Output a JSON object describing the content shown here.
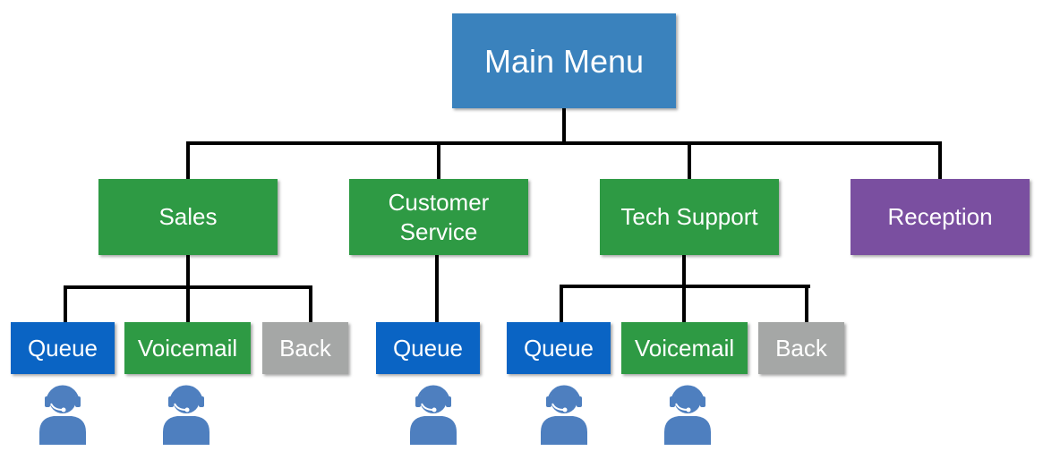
{
  "colors": {
    "main": "#3a82bd",
    "department": "#2e9a44",
    "reception": "#7a4fa0",
    "queue": "#0a64c4",
    "voicemail": "#2e9a44",
    "back": "#a5a7a6",
    "agent_icon": "#4e7fbf",
    "connector": "#000000"
  },
  "root": {
    "label": "Main Menu",
    "type": "main"
  },
  "departments": [
    {
      "label": "Sales",
      "type": "department",
      "options": [
        {
          "label": "Queue",
          "type": "queue",
          "agent": true
        },
        {
          "label": "Voicemail",
          "type": "voicemail",
          "agent": true
        },
        {
          "label": "Back",
          "type": "back",
          "agent": false
        }
      ]
    },
    {
      "label": "Customer Service",
      "label_line1": "Customer",
      "label_line2": "Service",
      "type": "department",
      "options": [
        {
          "label": "Queue",
          "type": "queue",
          "agent": true
        }
      ]
    },
    {
      "label": "Tech Support",
      "type": "department",
      "options": [
        {
          "label": "Queue",
          "type": "queue",
          "agent": true
        },
        {
          "label": "Voicemail",
          "type": "voicemail",
          "agent": true
        },
        {
          "label": "Back",
          "type": "back",
          "agent": false
        }
      ]
    },
    {
      "label": "Reception",
      "type": "reception",
      "options": []
    }
  ],
  "icons": {
    "agent": "headset-agent-icon"
  }
}
